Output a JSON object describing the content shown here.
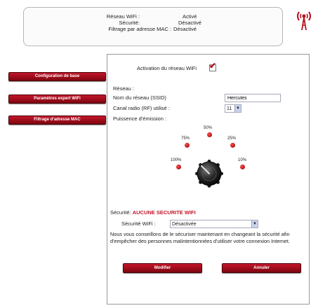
{
  "status": {
    "wifi_label": "Réseau WiFi :",
    "wifi_value": "Activé",
    "security_label": "Sécurité:",
    "security_value": "Désactivé",
    "mac_label": "Filtrage par adresse MAC :",
    "mac_value": "Désactivé"
  },
  "sidebar": {
    "items": [
      {
        "label": "Configuration de base"
      },
      {
        "label": "Paramètres expert WiFi"
      },
      {
        "label": "Filtrage d'adresse MAC"
      }
    ]
  },
  "main": {
    "activation_label": "Activation du réseau WiFi",
    "activation_checked": true,
    "network_heading": "Réseau :",
    "ssid_label": "Nom du réseau (SSID)",
    "ssid_value": "Hercules",
    "channel_label": "Canal radio (RF) utilisé :",
    "channel_value": "11",
    "power_label": "Puissence d'émission :",
    "power_levels": [
      "100%",
      "75%",
      "50%",
      "25%",
      "10%"
    ],
    "security_label": "Sécurité:",
    "security_warning": "AUCUNE SECURITE WIFI",
    "security_wifi_label": "Sécurité WiFi :",
    "security_wifi_value": "Désactivée",
    "advice": "Nous vous conseillons de le sécuriser maintenant en changeant la sécurité afin d'empêcher des personnes malintentionnées d'utiliser votre connexion Internet.",
    "modify_label": "Modifier",
    "cancel_label": "Annuler"
  },
  "colors": {
    "accent_red": "#c4162a",
    "accent_dark": "#7e0610"
  },
  "icons": {
    "logo": "wifi-antenna-icon",
    "dropdown": "chevron-down-icon"
  }
}
